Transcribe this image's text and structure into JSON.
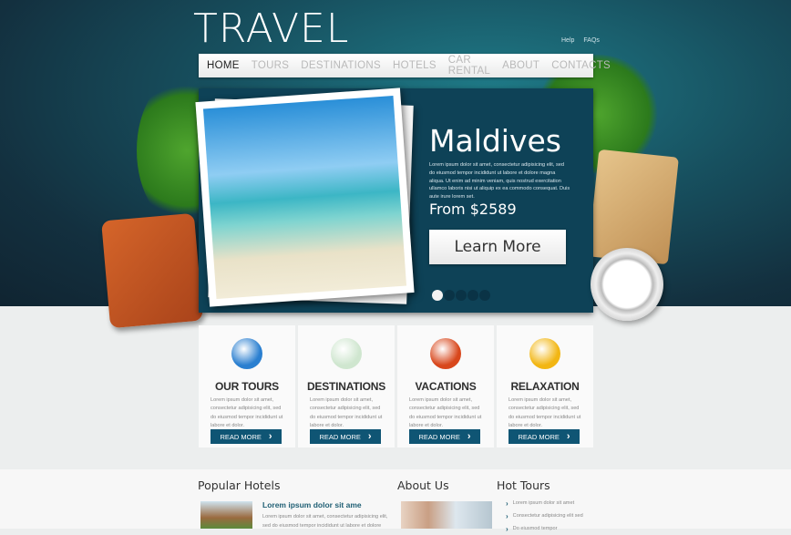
{
  "header": {
    "logo": "TRAVEL",
    "links": [
      "Help",
      "FAQs"
    ]
  },
  "nav": [
    {
      "label": "HOME",
      "active": true
    },
    {
      "label": "TOURS"
    },
    {
      "label": "DESTINATIONS"
    },
    {
      "label": "HOTELS"
    },
    {
      "label": "CAR RENTAL"
    },
    {
      "label": "ABOUT"
    },
    {
      "label": "CONTACTS"
    }
  ],
  "slider": {
    "title": "Maldives",
    "text": "Lorem ipsum dolor sit amet, consectetur adipisicing elit, sed do eiusmod tempor incididunt ut labore et dolore magna aliqua. Ut enim ad minim veniam, quis nostrud exercitation ullamco laboris nisi ut aliquip ex ea commodo consequat. Duis aute irure lorem set.",
    "price": "From $2589",
    "button": "Learn More",
    "slides": 5,
    "active_slide": 1
  },
  "features": [
    {
      "title": "OUR TOURS",
      "text": "Lorem ipsum dolor sit amet, consectetur adipisicing elit, sed do eiusmod tempor incididunt ut labore et dolor.",
      "button": "READ MORE",
      "icon": "globe-icon",
      "color": "#2a7fd0"
    },
    {
      "title": "DESTINATIONS",
      "text": "Lorem ipsum dolor sit amet, consectetur adipisicing elit, sed do eiusmod tempor incididunt ut labore et dolor.",
      "button": "READ MORE",
      "icon": "flip-flops-icon",
      "color": "#cfe6cf"
    },
    {
      "title": "VACATIONS",
      "text": "Lorem ipsum dolor sit amet, consectetur adipisicing elit, sed do eiusmod tempor incididunt ut labore et dolor.",
      "button": "READ MORE",
      "icon": "starfish-icon",
      "color": "#d8471c"
    },
    {
      "title": "RELAXATION",
      "text": "Lorem ipsum dolor sit amet, consectetur adipisicing elit, sed do eiusmod tempor incididunt ut labore et dolor.",
      "button": "READ MORE",
      "icon": "cocktail-icon",
      "color": "#f2b613"
    }
  ],
  "bottom": {
    "popular_hotels": {
      "heading": "Popular Hotels",
      "title": "Lorem ipsum dolor sit ame",
      "text": "Lorem ipsum dolor sit amet, consectetur adipisicing elit, sed do eiusmod tempor incididunt ut labore et dolore"
    },
    "about": {
      "heading": "About Us"
    },
    "hot_tours": {
      "heading": "Hot Tours",
      "items": [
        "Lorem ipsum dolor sit amet",
        "Consectetur adipisicing elit sed",
        "Do eiusmod tempor"
      ]
    }
  }
}
